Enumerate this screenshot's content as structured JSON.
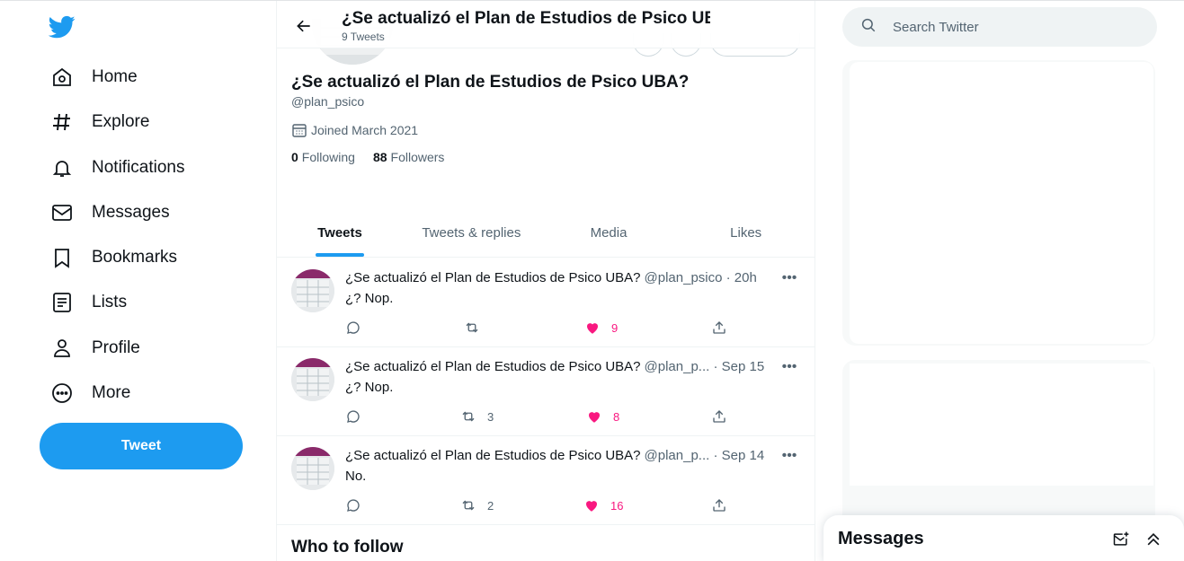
{
  "nav": {
    "logo": "twitter-bird-icon",
    "items": [
      {
        "label": "Home",
        "icon": "home-icon"
      },
      {
        "label": "Explore",
        "icon": "hashtag-icon"
      },
      {
        "label": "Notifications",
        "icon": "bell-icon"
      },
      {
        "label": "Messages",
        "icon": "envelope-icon"
      },
      {
        "label": "Bookmarks",
        "icon": "bookmark-icon"
      },
      {
        "label": "Lists",
        "icon": "list-icon"
      },
      {
        "label": "Profile",
        "icon": "person-icon"
      },
      {
        "label": "More",
        "icon": "more-circle-icon"
      }
    ],
    "tweet_button": "Tweet"
  },
  "header": {
    "title": "¿Se actualizó el Plan de Estudios de Psico UBA?",
    "subtitle": "9 Tweets"
  },
  "profile": {
    "name": "¿Se actualizó el Plan de Estudios de Psico UBA?",
    "handle": "@plan_psico",
    "joined": "Joined March 2021",
    "following_count": "0",
    "following_label": "Following",
    "followers_count": "88",
    "followers_label": "Followers"
  },
  "tabs": [
    "Tweets",
    "Tweets & replies",
    "Media",
    "Likes"
  ],
  "tweets": [
    {
      "name": "¿Se actualizó el Plan de Estudios de Psico UBA?",
      "meta": "@plan_psico · 20h",
      "text": "¿? Nop.",
      "retweets": "",
      "likes": "9"
    },
    {
      "name": "¿Se actualizó el Plan de Estudios de Psico UBA?",
      "meta": "@plan_p... · Sep 15",
      "text": "¿? Nop.",
      "retweets": "3",
      "likes": "8"
    },
    {
      "name": "¿Se actualizó el Plan de Estudios de Psico UBA?",
      "meta": "@plan_p... · Sep 14",
      "text": "No.",
      "retweets": "2",
      "likes": "16"
    }
  ],
  "who_to_follow": "Who to follow",
  "search": {
    "placeholder": "Search Twitter"
  },
  "messages_drawer": {
    "title": "Messages"
  },
  "colors": {
    "accent": "#1d9bf0",
    "like": "#f91880",
    "muted": "#536471",
    "text": "#0f1419"
  }
}
